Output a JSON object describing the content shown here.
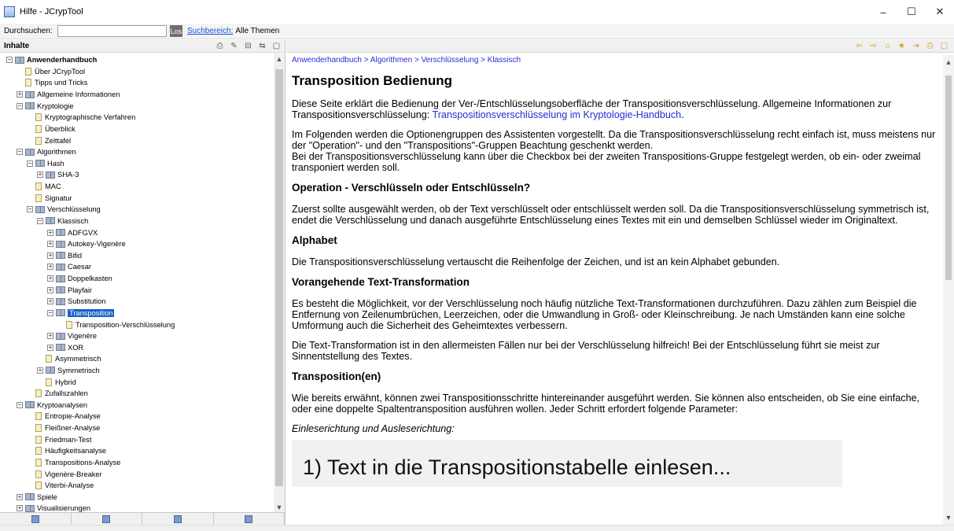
{
  "window": {
    "title": "Hilfe - JCrypTool",
    "minimize": "–",
    "maximize": "☐",
    "close": "✕"
  },
  "search": {
    "label": "Durchsuchen:",
    "value": "",
    "go_label": "Los",
    "scope_link": "Suchbereich:",
    "scope_value": "Alle Themen"
  },
  "left_header": {
    "title": "Inhalte"
  },
  "tree": [
    {
      "label": "Anwenderhandbuch",
      "level": 0,
      "expander": "minus",
      "icon": "book-icon",
      "bold": true
    },
    {
      "label": "Über JCrypTool",
      "level": 1,
      "expander": "none",
      "icon": "page-icon"
    },
    {
      "label": "Tipps und Tricks",
      "level": 1,
      "expander": "none",
      "icon": "page-icon"
    },
    {
      "label": "Allgemeine Informationen",
      "level": 1,
      "expander": "plus",
      "icon": "book-icon"
    },
    {
      "label": "Kryptologie",
      "level": 1,
      "expander": "minus",
      "icon": "book-icon"
    },
    {
      "label": "Kryptographische Verfahren",
      "level": 2,
      "expander": "none",
      "icon": "page-icon"
    },
    {
      "label": "Überblick",
      "level": 2,
      "expander": "none",
      "icon": "page-icon"
    },
    {
      "label": "Zeittafel",
      "level": 2,
      "expander": "none",
      "icon": "page-icon"
    },
    {
      "label": "Algorithmen",
      "level": 1,
      "expander": "minus",
      "icon": "book-icon"
    },
    {
      "label": "Hash",
      "level": 2,
      "expander": "minus",
      "icon": "book-icon"
    },
    {
      "label": "SHA-3",
      "level": 3,
      "expander": "plus",
      "icon": "book-icon"
    },
    {
      "label": "MAC",
      "level": 2,
      "expander": "none",
      "icon": "page-icon"
    },
    {
      "label": "Signatur",
      "level": 2,
      "expander": "none",
      "icon": "page-icon"
    },
    {
      "label": "Verschlüsselung",
      "level": 2,
      "expander": "minus",
      "icon": "book-icon"
    },
    {
      "label": "Klassisch",
      "level": 3,
      "expander": "minus",
      "icon": "book-icon"
    },
    {
      "label": "ADFGVX",
      "level": 4,
      "expander": "plus",
      "icon": "book-icon"
    },
    {
      "label": "Autokey-Vigenère",
      "level": 4,
      "expander": "plus",
      "icon": "book-icon"
    },
    {
      "label": "Bifid",
      "level": 4,
      "expander": "plus",
      "icon": "book-icon"
    },
    {
      "label": "Caesar",
      "level": 4,
      "expander": "plus",
      "icon": "book-icon"
    },
    {
      "label": "Doppelkasten",
      "level": 4,
      "expander": "plus",
      "icon": "book-icon"
    },
    {
      "label": "Playfair",
      "level": 4,
      "expander": "plus",
      "icon": "book-icon"
    },
    {
      "label": "Substitution",
      "level": 4,
      "expander": "plus",
      "icon": "book-icon"
    },
    {
      "label": "Transposition",
      "level": 4,
      "expander": "minus",
      "icon": "book-icon",
      "selected": true
    },
    {
      "label": "Transposition-Verschlüsselung",
      "level": 5,
      "expander": "none",
      "icon": "page-icon"
    },
    {
      "label": "Vigenère",
      "level": 4,
      "expander": "plus",
      "icon": "book-icon"
    },
    {
      "label": "XOR",
      "level": 4,
      "expander": "plus",
      "icon": "book-icon"
    },
    {
      "label": "Asymmetrisch",
      "level": 3,
      "expander": "none",
      "icon": "page-icon"
    },
    {
      "label": "Symmetrisch",
      "level": 3,
      "expander": "plus",
      "icon": "book-icon"
    },
    {
      "label": "Hybrid",
      "level": 3,
      "expander": "none",
      "icon": "page-icon"
    },
    {
      "label": "Zufallszahlen",
      "level": 2,
      "expander": "none",
      "icon": "page-icon"
    },
    {
      "label": "Kryptoanalysen",
      "level": 1,
      "expander": "minus",
      "icon": "book-icon"
    },
    {
      "label": "Entropie-Analyse",
      "level": 2,
      "expander": "none",
      "icon": "page-icon"
    },
    {
      "label": "Fleißner-Analyse",
      "level": 2,
      "expander": "none",
      "icon": "page-icon"
    },
    {
      "label": "Friedman-Test",
      "level": 2,
      "expander": "none",
      "icon": "page-icon"
    },
    {
      "label": "Häufigkeitsanalyse",
      "level": 2,
      "expander": "none",
      "icon": "page-icon"
    },
    {
      "label": "Transpositions-Analyse",
      "level": 2,
      "expander": "none",
      "icon": "page-icon"
    },
    {
      "label": "Vigenère-Breaker",
      "level": 2,
      "expander": "none",
      "icon": "page-icon"
    },
    {
      "label": "Viterbi-Analyse",
      "level": 2,
      "expander": "none",
      "icon": "page-icon"
    },
    {
      "label": "Spiele",
      "level": 1,
      "expander": "plus",
      "icon": "book-icon"
    },
    {
      "label": "Visualisierungen",
      "level": 1,
      "expander": "plus",
      "icon": "book-icon"
    }
  ],
  "content": {
    "breadcrumb": "Anwenderhandbuch > Algorithmen > Verschlüsselung > Klassisch",
    "title": "Transposition Bedienung",
    "intro_text": "Diese Seite erklärt die Bedienung der Ver-/Entschlüsselungsoberfläche der Transpositionsverschlüsselung. Allgemeine Informationen zur Transpositionsverschlüsselung: ",
    "intro_link": "Transpositionsverschlüsselung im Kryptologie-Handbuch",
    "intro_end": ".",
    "p2_line1": "Im Folgenden werden die Optionengruppen des Assistenten vorgestellt. Da die Transpositionsverschlüsselung recht einfach ist, muss meistens nur der \"Operation\"- und den \"Transpositions\"-Gruppen Beachtung geschenkt werden.",
    "p2_line2": "Bei der Transpositionsverschlüsselung kann über die Checkbox bei der zweiten Transpositions-Gruppe festgelegt werden, ob ein- oder zweimal transponiert werden soll.",
    "h_operation": "Operation - Verschlüsseln oder Entschlüsseln?",
    "p_operation": "Zuerst sollte ausgewählt werden, ob der Text verschlüsselt oder entschlüsselt werden soll. Da die Transpositionsverschlüsselung symmetrisch ist, endet die Verschlüsselung und danach ausgeführte Entschlüsselung eines Textes mit ein und demselben Schlüssel wieder im Originaltext.",
    "h_alphabet": "Alphabet",
    "p_alphabet": "Die Transpositionsverschlüsselung vertauscht die Reihenfolge der Zeichen, und ist an kein Alphabet gebunden.",
    "h_transform": "Vorangehende Text-Transformation",
    "p_transform1": "Es besteht die Möglichkeit, vor der Verschlüsselung noch häufig nützliche Text-Transformationen durchzuführen. Dazu zählen zum Beispiel die Entfernung von Zeilenumbrüchen, Leerzeichen, oder die Umwandlung in Groß- oder Kleinschreibung. Je nach Umständen kann eine solche Umformung auch die Sicherheit des Geheimtextes verbessern.",
    "p_transform2": "Die Text-Transformation ist in den allermeisten Fällen nur bei der Verschlüsselung hilfreich! Bei der Entschlüsselung führt sie meist zur Sinnentstellung des Textes.",
    "h_transposition": "Transposition(en)",
    "p_transposition": "Wie bereits erwähnt, können zwei Transpositionsschritte hintereinander ausgeführt werden. Sie können also entscheiden, ob Sie eine einfache, oder eine doppelte Spaltentransposition ausführen wollen. Jeder Schritt erfordert folgende Parameter:",
    "p_em": "Einleserichtung und Ausleserichtung:",
    "figure_text": "1) Text in die Transpositionstabelle einlesen..."
  }
}
